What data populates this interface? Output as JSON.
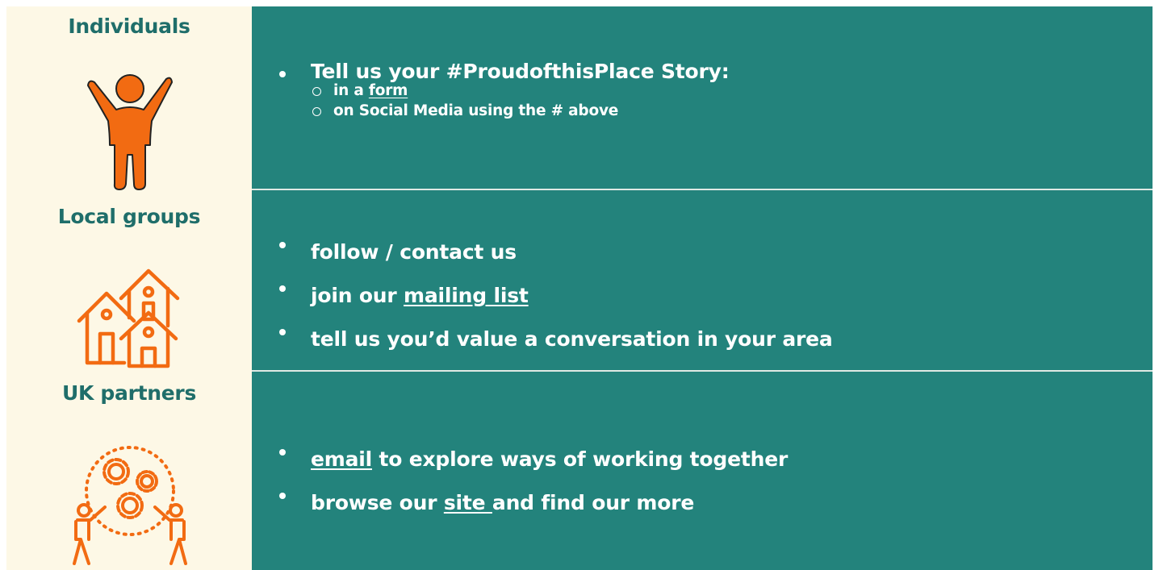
{
  "rows": [
    {
      "heading": "Individuals",
      "icon": "person-arms-raised-icon",
      "items": [
        {
          "text": "Tell us your #ProudofthisPlace Story:",
          "subitems": [
            {
              "prefix": "in a ",
              "link": "form",
              "suffix": ""
            },
            {
              "text": "on Social Media using the # above"
            }
          ]
        }
      ]
    },
    {
      "heading": "Local groups",
      "icon": "houses-icon",
      "items": [
        {
          "text": "follow / contact us"
        },
        {
          "prefix": "join our ",
          "link": "mailing list",
          "suffix": ""
        },
        {
          "text": "tell us you’d value a conversation in your area"
        }
      ]
    },
    {
      "heading": "UK partners",
      "icon": "people-gears-teamwork-icon",
      "items": [
        {
          "prefix": "",
          "link": "email",
          "suffix": " to explore ways of working together"
        },
        {
          "prefix": "browse our ",
          "link": "site ",
          "suffix": "and find our more"
        }
      ]
    }
  ],
  "colors": {
    "left_bg": "#fdf8e6",
    "right_bg": "#23837c",
    "heading": "#1f6e6a",
    "icon_orange": "#f26b12",
    "text": "#ffffff"
  }
}
